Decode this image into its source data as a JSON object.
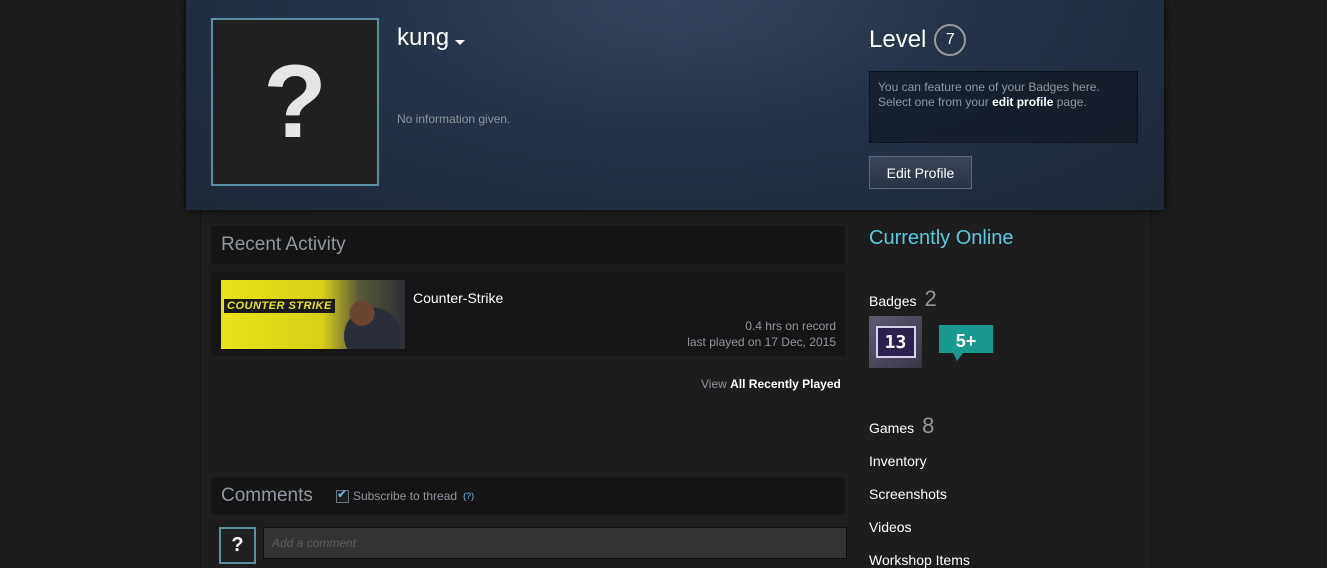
{
  "profile": {
    "avatar_glyph": "?",
    "persona_name": "kung",
    "summary": "No information given."
  },
  "level": {
    "label": "Level",
    "value": "7"
  },
  "badge_feature": {
    "text_1": "You can feature one of your Badges here.",
    "text_2": "Select one from your ",
    "link": "edit profile",
    "text_3": " page."
  },
  "edit_button": "Edit Profile",
  "recent_activity": {
    "title": "Recent Activity",
    "game": {
      "logo_text": "COUNTER STRIKE",
      "name": "Counter-Strike",
      "hours": "0.4 hrs on record",
      "last_played": "last played on 17 Dec, 2015"
    },
    "view_prefix": "View ",
    "view_link": "All Recently Played"
  },
  "comments": {
    "title": "Comments",
    "subscribe_label": "Subscribe to thread",
    "help": "(?)",
    "commenter_avatar": "?",
    "placeholder": "Add a comment"
  },
  "sidebar": {
    "status": "Currently Online",
    "badges": {
      "label": "Badges",
      "count": "2",
      "badge_1": "13",
      "badge_2": "5+"
    },
    "games": {
      "label": "Games",
      "count": "8"
    },
    "links": [
      "Inventory",
      "Screenshots",
      "Videos",
      "Workshop Items"
    ]
  },
  "colors": {
    "online": "#57cbde",
    "avatar_border": "#5a8ea3"
  }
}
